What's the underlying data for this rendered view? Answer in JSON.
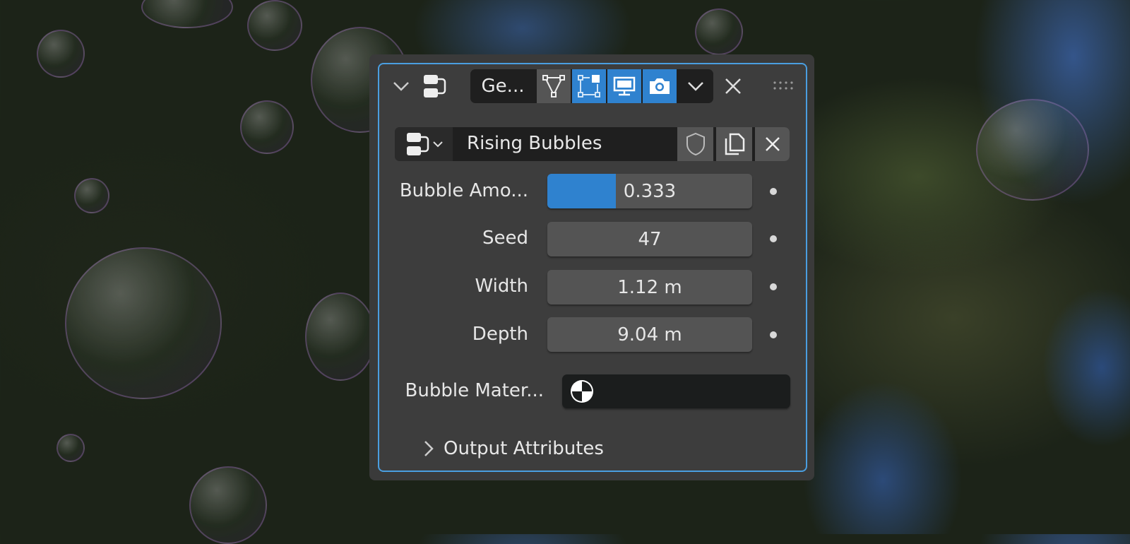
{
  "header": {
    "modifier_tab_label": "Ge...",
    "toggles": [
      {
        "name": "edit-mode",
        "active": false
      },
      {
        "name": "cage",
        "active": true
      },
      {
        "name": "viewport",
        "active": true
      },
      {
        "name": "render",
        "active": true
      }
    ]
  },
  "node_group": {
    "name": "Rising Bubbles"
  },
  "inputs": [
    {
      "label": "Bubble Amo...",
      "value": "0.333",
      "fraction": 0.333
    },
    {
      "label": "Seed",
      "value": "47"
    },
    {
      "label": "Width",
      "value": "1.12 m"
    },
    {
      "label": "Depth",
      "value": "9.04 m"
    }
  ],
  "material": {
    "label": "Bubble Mater..."
  },
  "output_attributes": {
    "label": "Output Attributes"
  },
  "colors": {
    "accent": "#2f82cf",
    "panel": "#3d3d3d",
    "border": "#4a9ee0"
  }
}
